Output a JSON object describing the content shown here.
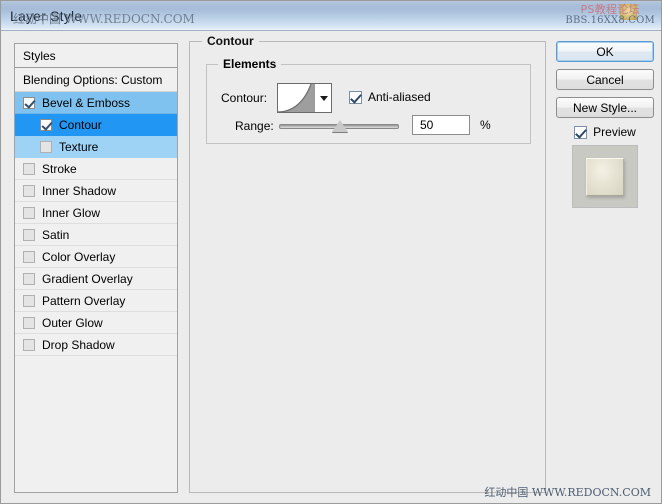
{
  "window": {
    "title": "Layer Style"
  },
  "watermarks": {
    "top_left": "红动中国 WWW.REDOCN.COM",
    "top_right_line1": "PS教程论坛",
    "top_right_line2": "BBS.16XX8.COM",
    "bottom": "红动中国 WWW.REDOCN.COM"
  },
  "styles_panel": {
    "header": "Styles",
    "blending_options": "Blending Options: Custom",
    "items": [
      {
        "label": "Bevel & Emboss",
        "checked": true,
        "indent": false,
        "state": "sel-light"
      },
      {
        "label": "Contour",
        "checked": true,
        "indent": true,
        "state": "sel-strong"
      },
      {
        "label": "Texture",
        "checked": false,
        "indent": true,
        "state": "sel-pale"
      },
      {
        "label": "Stroke",
        "checked": false,
        "indent": false,
        "state": ""
      },
      {
        "label": "Inner Shadow",
        "checked": false,
        "indent": false,
        "state": ""
      },
      {
        "label": "Inner Glow",
        "checked": false,
        "indent": false,
        "state": ""
      },
      {
        "label": "Satin",
        "checked": false,
        "indent": false,
        "state": ""
      },
      {
        "label": "Color Overlay",
        "checked": false,
        "indent": false,
        "state": ""
      },
      {
        "label": "Gradient Overlay",
        "checked": false,
        "indent": false,
        "state": ""
      },
      {
        "label": "Pattern Overlay",
        "checked": false,
        "indent": false,
        "state": ""
      },
      {
        "label": "Outer Glow",
        "checked": false,
        "indent": false,
        "state": ""
      },
      {
        "label": "Drop Shadow",
        "checked": false,
        "indent": false,
        "state": ""
      }
    ]
  },
  "contour_panel": {
    "group_title": "Contour",
    "elements_title": "Elements",
    "contour_label": "Contour:",
    "contour_swatch_icon": "contour-curve-icon",
    "dropdown_icon": "chevron-down-icon",
    "antialiased_label": "Anti-aliased",
    "antialiased_checked": true,
    "range_label": "Range:",
    "range_value": "50",
    "range_percent_symbol": "%",
    "range_slider_position_pct": 50
  },
  "buttons": {
    "ok": "OK",
    "cancel": "Cancel",
    "new_style": "New Style...",
    "preview_label": "Preview",
    "preview_checked": true
  },
  "colors": {
    "accent_selected": "#2196f3",
    "accent_selected_light": "#7fc2f0",
    "dialog_bg": "#ececec",
    "titlebar_blue": "#aabfd8",
    "primary_button_border": "#5b9bd5"
  }
}
